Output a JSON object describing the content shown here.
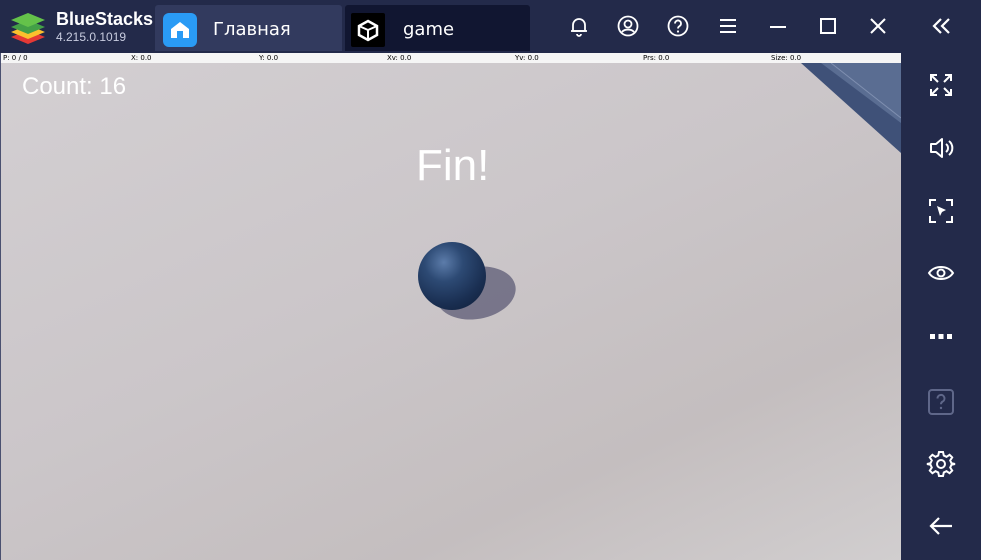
{
  "app": {
    "name": "BlueStacks",
    "version": "4.215.0.1019"
  },
  "tabs": [
    {
      "label": "Главная",
      "icon": "home-icon",
      "active": false
    },
    {
      "label": "game",
      "icon": "unity-icon",
      "active": true
    }
  ],
  "titlebar_buttons": [
    "bell-icon",
    "account-icon",
    "help-icon",
    "menu-icon",
    "minimize-icon",
    "maximize-icon",
    "close-icon",
    "collapse-sidebar-icon"
  ],
  "debug_bar": {
    "pointer": "P: 0 / 0",
    "x": "X: 0.0",
    "y": "Y: 0.0",
    "xv": "Xv: 0.0",
    "yv": "Yv: 0.0",
    "prs": "Prs: 0.0",
    "size": "Size: 0.0"
  },
  "game": {
    "count_text": "Count: 16",
    "status_text": "Fin!",
    "ball_color": "#1f3658",
    "floor_color": "#cbc6c9"
  },
  "sidebar_buttons": [
    "fullscreen-icon",
    "volume-icon",
    "screenshot-cursor-icon",
    "eye-icon",
    "more-icon",
    "help-box-icon",
    "settings-icon",
    "back-icon"
  ],
  "colors": {
    "chrome_bg": "#232a4a",
    "home_tab_bg": "#323a5e",
    "game_tab_bg": "#111631",
    "accent_blue": "#2a9bf5"
  }
}
